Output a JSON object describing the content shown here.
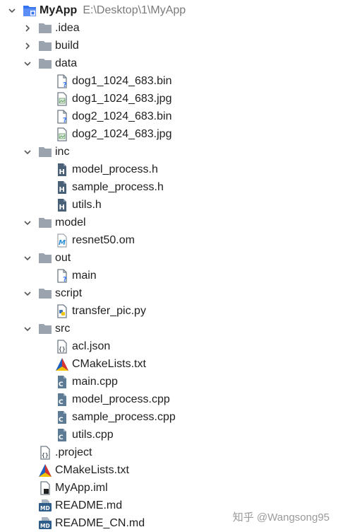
{
  "project": {
    "name": "MyApp",
    "path": "E:\\Desktop\\1\\MyApp"
  },
  "tree": [
    {
      "depth": 0,
      "type": "folder",
      "name": ".idea",
      "expanded": false,
      "icon": "folder-icon"
    },
    {
      "depth": 0,
      "type": "folder",
      "name": "build",
      "expanded": false,
      "icon": "folder-icon"
    },
    {
      "depth": 0,
      "type": "folder",
      "name": "data",
      "expanded": true,
      "icon": "folder-icon"
    },
    {
      "depth": 1,
      "type": "file",
      "name": "dog1_1024_683.bin",
      "icon": "unknown-file-icon"
    },
    {
      "depth": 1,
      "type": "file",
      "name": "dog1_1024_683.jpg",
      "icon": "image-file-icon"
    },
    {
      "depth": 1,
      "type": "file",
      "name": "dog2_1024_683.bin",
      "icon": "unknown-file-icon"
    },
    {
      "depth": 1,
      "type": "file",
      "name": "dog2_1024_683.jpg",
      "icon": "image-file-icon"
    },
    {
      "depth": 0,
      "type": "folder",
      "name": "inc",
      "expanded": true,
      "icon": "folder-icon"
    },
    {
      "depth": 1,
      "type": "file",
      "name": "model_process.h",
      "icon": "header-file-icon"
    },
    {
      "depth": 1,
      "type": "file",
      "name": "sample_process.h",
      "icon": "header-file-icon"
    },
    {
      "depth": 1,
      "type": "file",
      "name": "utils.h",
      "icon": "header-file-icon"
    },
    {
      "depth": 0,
      "type": "folder",
      "name": "model",
      "expanded": true,
      "icon": "folder-icon"
    },
    {
      "depth": 1,
      "type": "file",
      "name": "resnet50.om",
      "icon": "model-file-icon"
    },
    {
      "depth": 0,
      "type": "folder",
      "name": "out",
      "expanded": true,
      "icon": "folder-icon"
    },
    {
      "depth": 1,
      "type": "file",
      "name": "main",
      "icon": "unknown-file-icon"
    },
    {
      "depth": 0,
      "type": "folder",
      "name": "script",
      "expanded": true,
      "icon": "folder-icon"
    },
    {
      "depth": 1,
      "type": "file",
      "name": "transfer_pic.py",
      "icon": "python-file-icon"
    },
    {
      "depth": 0,
      "type": "folder",
      "name": "src",
      "expanded": true,
      "icon": "folder-icon"
    },
    {
      "depth": 1,
      "type": "file",
      "name": "acl.json",
      "icon": "json-file-icon"
    },
    {
      "depth": 1,
      "type": "file",
      "name": "CMakeLists.txt",
      "icon": "cmake-file-icon"
    },
    {
      "depth": 1,
      "type": "file",
      "name": "main.cpp",
      "icon": "cpp-file-icon"
    },
    {
      "depth": 1,
      "type": "file",
      "name": "model_process.cpp",
      "icon": "cpp-file-icon"
    },
    {
      "depth": 1,
      "type": "file",
      "name": "sample_process.cpp",
      "icon": "cpp-file-icon"
    },
    {
      "depth": 1,
      "type": "file",
      "name": "utils.cpp",
      "icon": "cpp-file-icon"
    },
    {
      "depth": 0,
      "type": "file",
      "name": ".project",
      "icon": "xml-file-icon"
    },
    {
      "depth": 0,
      "type": "file",
      "name": "CMakeLists.txt",
      "icon": "cmake-file-icon"
    },
    {
      "depth": 0,
      "type": "file",
      "name": "MyApp.iml",
      "icon": "iml-file-icon"
    },
    {
      "depth": 0,
      "type": "file",
      "name": "README.md",
      "icon": "markdown-file-icon"
    },
    {
      "depth": 0,
      "type": "file",
      "name": "README_CN.md",
      "icon": "markdown-file-icon"
    }
  ],
  "watermark": "知乎 @Wangsong95",
  "colors": {
    "folder": "#9aa3ae",
    "root_folder": "#3574f0",
    "header_icon": "#4a6076",
    "cpp_icon": "#5d7b94",
    "cmake_blue": "#1f5fbf",
    "cmake_red": "#d6322f",
    "cmake_yellow": "#f2c200",
    "markdown": "#2f5d8a"
  }
}
